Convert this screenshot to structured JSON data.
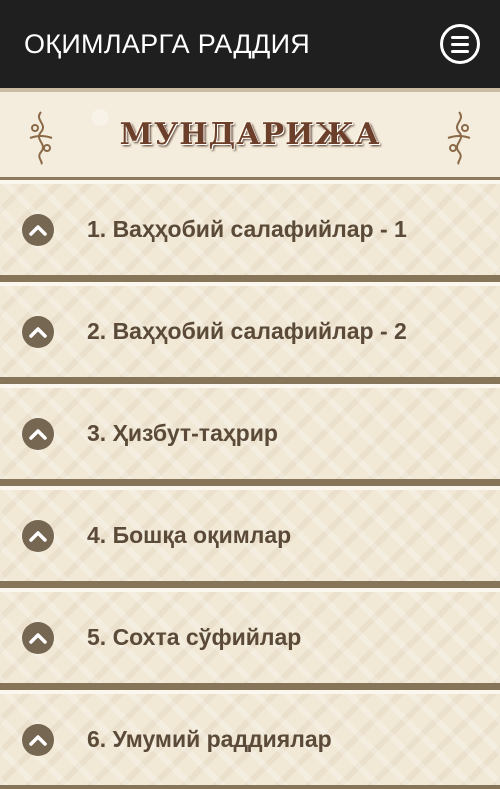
{
  "app_bar": {
    "title": "ОҚИМЛАРГА РАДДИЯ",
    "menu_icon": "menu-icon"
  },
  "header": {
    "title": "МУНДАРИЖА",
    "left_ornament": "ornament-icon",
    "right_ornament": "ornament-icon"
  },
  "items": [
    {
      "label": "1. Ваҳҳобий салафийлар - 1",
      "icon": "chevron-up-icon"
    },
    {
      "label": "2. Ваҳҳобий салафийлар - 2",
      "icon": "chevron-up-icon"
    },
    {
      "label": "3. Ҳизбут-таҳрир",
      "icon": "chevron-up-icon"
    },
    {
      "label": "4. Бошқа оқимлар",
      "icon": "chevron-up-icon"
    },
    {
      "label": "5. Сохта сўфийлар",
      "icon": "chevron-up-icon"
    },
    {
      "label": "6. Умумий раддиялар",
      "icon": "chevron-up-icon"
    }
  ],
  "colors": {
    "app_bar": "#1f1f1f",
    "background": "#f1e8d6",
    "item_text": "#5a4a37",
    "chevron_circle": "#766753",
    "separator": "#867559"
  }
}
